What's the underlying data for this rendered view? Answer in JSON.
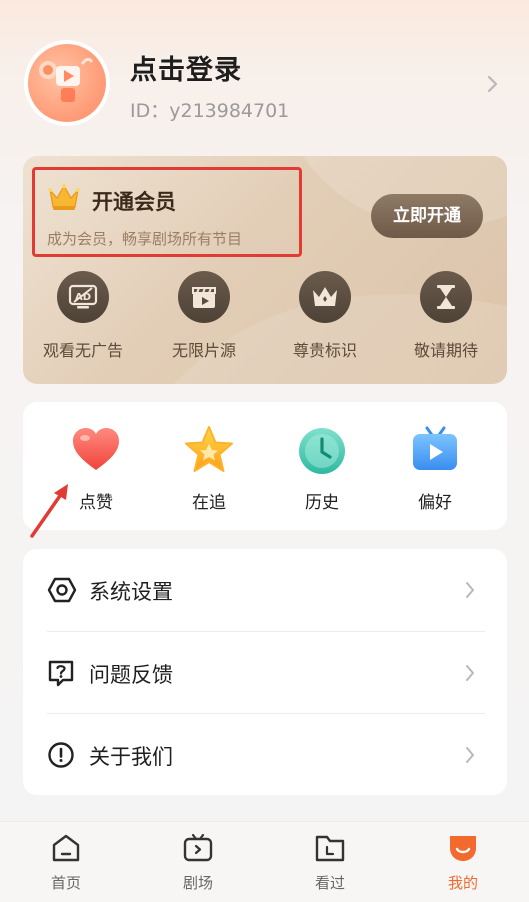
{
  "profile": {
    "title": "点击登录",
    "user_id": "ID：y213984701",
    "avatar_icon": "app-logo-avatar",
    "chevron_icon": "chevron-right-icon"
  },
  "vip": {
    "title": "开通会员",
    "subtitle": "成为会员，畅享剧场所有节目",
    "button_label": "立即开通",
    "crown_icon": "crown-icon",
    "highlight_color": "#e23b34",
    "perks": [
      {
        "label": "观看无广告",
        "icon": "no-ads-icon"
      },
      {
        "label": "无限片源",
        "icon": "clapperboard-icon"
      },
      {
        "label": "尊贵标识",
        "icon": "crown-badge-icon"
      },
      {
        "label": "敬请期待",
        "icon": "hourglass-icon"
      }
    ]
  },
  "quick": {
    "items": [
      {
        "label": "点赞",
        "icon": "heart-icon"
      },
      {
        "label": "在追",
        "icon": "star-icon"
      },
      {
        "label": "历史",
        "icon": "clock-icon"
      },
      {
        "label": "偏好",
        "icon": "tv-play-icon"
      }
    ],
    "annotation_color": "#e23b34"
  },
  "menu": {
    "items": [
      {
        "label": "系统设置",
        "icon": "settings-hexagon-icon"
      },
      {
        "label": "问题反馈",
        "icon": "feedback-question-icon"
      },
      {
        "label": "关于我们",
        "icon": "info-exclamation-icon"
      }
    ]
  },
  "tabbar": {
    "tabs": [
      {
        "label": "首页",
        "icon": "home-icon",
        "active": false
      },
      {
        "label": "剧场",
        "icon": "theater-tv-icon",
        "active": false
      },
      {
        "label": "看过",
        "icon": "watched-folder-icon",
        "active": false
      },
      {
        "label": "我的",
        "icon": "mine-icon",
        "active": true
      }
    ],
    "accent_color": "#f26a2e"
  }
}
